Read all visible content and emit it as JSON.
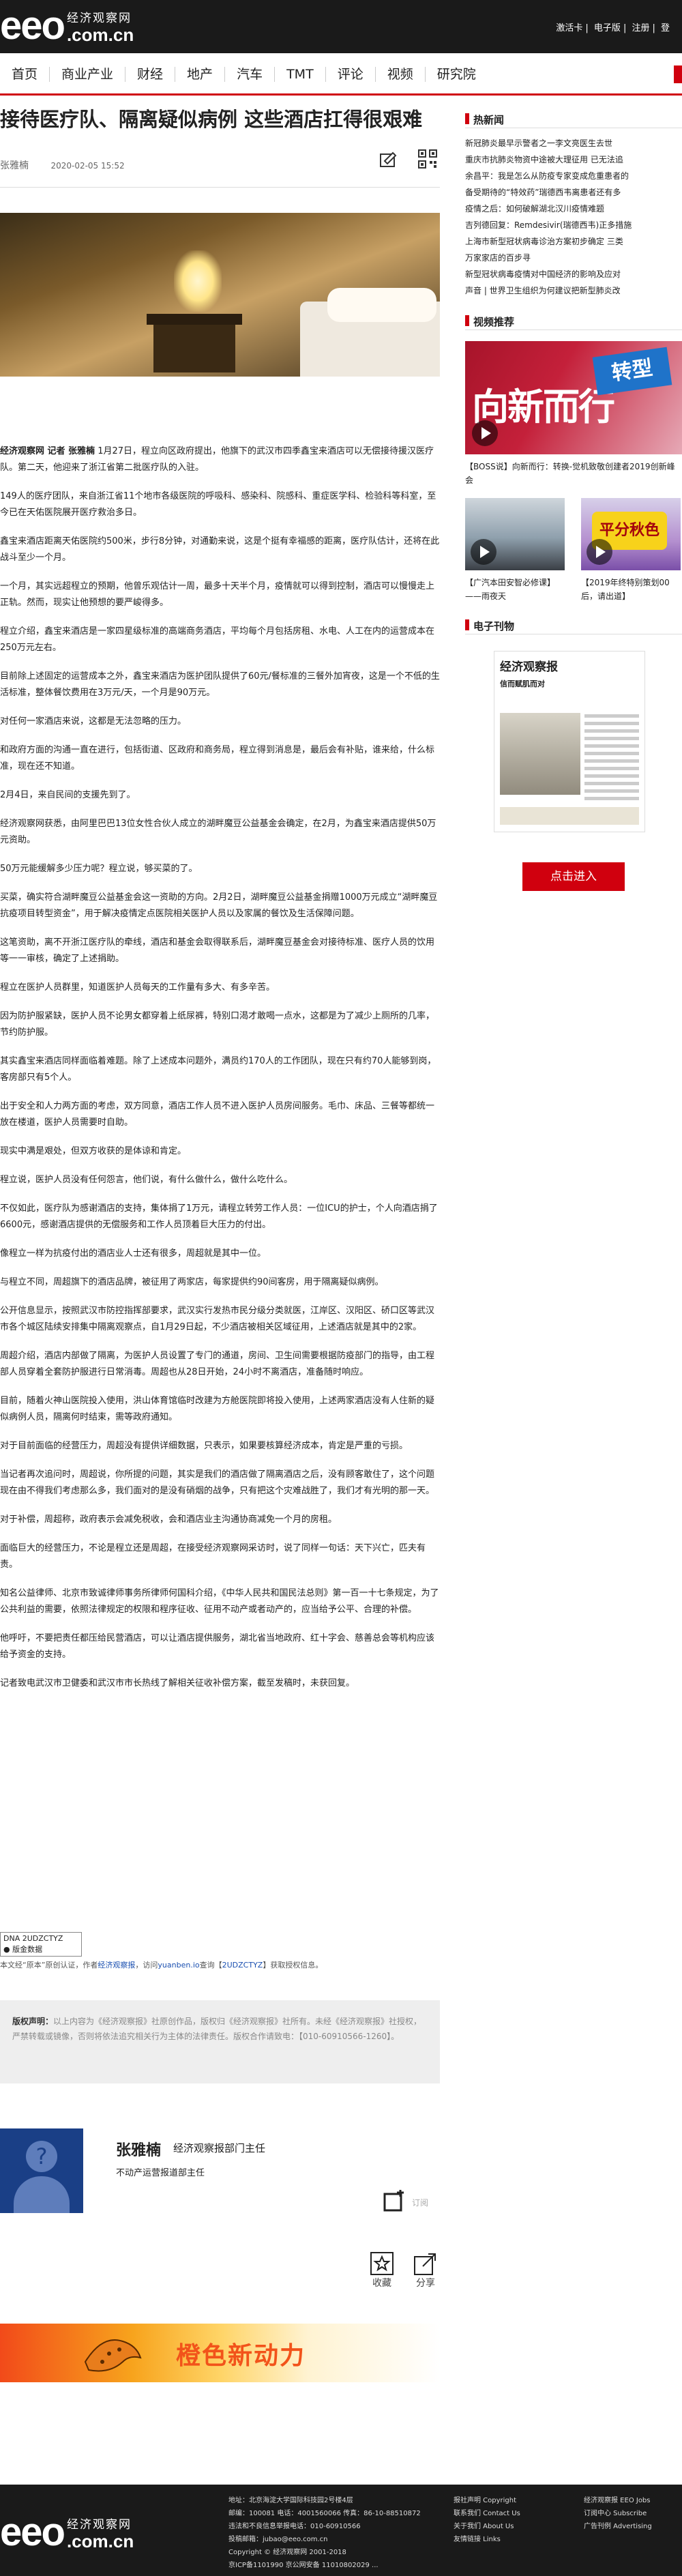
{
  "topbar": {
    "logo_word": "eeo",
    "logo_cn": "经济观察网",
    "logo_domain": ".com.cn",
    "links": [
      "激活卡",
      "电子版",
      "注册",
      "登"
    ]
  },
  "nav": [
    "首页",
    "商业产业",
    "财经",
    "地产",
    "汽车",
    "TMT",
    "评论",
    "视频",
    "研究院"
  ],
  "article": {
    "title": "接待医疗队、隔离疑似病例 这些酒店扛得很艰难",
    "author": "张雅楠",
    "date": "2020-02-05 15:52",
    "paragraphs": [
      [
        "经济观察网 记者 张雅楠",
        "1月27日，程立向区政府提出，他旗下的武汉市四季鑫宝来酒店可以无偿接待援汉医疗队。第二天，他迎来了浙江省第二批医疗队的入驻。"
      ],
      [
        "",
        "149人的医疗团队，来自浙江省11个地市各级医院的呼吸科、感染科、院感科、重症医学科、检验科等科室，至今已在天佑医院展开医疗救治多日。"
      ],
      [
        "",
        "鑫宝来酒店距离天佑医院约500米，步行8分钟，对通勤来说，这是个挺有幸福感的距离，医疗队估计，还将在此战斗至少一个月。"
      ],
      [
        "",
        "一个月，其实远超程立的预期，他曾乐观估计一周，最多十天半个月，疫情就可以得到控制，酒店可以慢慢走上正轨。然而，现实让他预想的要严峻得多。"
      ],
      [
        "",
        "程立介绍，鑫宝来酒店是一家四星级标准的高端商务酒店，平均每个月包括房租、水电、人工在内的运营成本在250万元左右。"
      ],
      [
        "",
        "目前除上述固定的运营成本之外，鑫宝来酒店为医护团队提供了60元/餐标准的三餐外加宵夜，这是一个不低的生活标准，整体餐饮费用在3万元/天，一个月是90万元。"
      ],
      [
        "",
        "对任何一家酒店来说，这都是无法忽略的压力。"
      ],
      [
        "",
        "和政府方面的沟通一直在进行，包括街道、区政府和商务局，程立得到消息是，最后会有补贴，谁来给，什么标准，现在还不知道。"
      ],
      [
        "",
        "2月4日，来自民间的支援先到了。"
      ],
      [
        "",
        "经济观察网获悉，由阿里巴巴13位女性合伙人成立的湖畔魔豆公益基金会确定，在2月，为鑫宝来酒店提供50万元资助。"
      ],
      [
        "",
        "50万元能缓解多少压力呢？程立说，够买菜的了。"
      ],
      [
        "",
        "买菜，确实符合湖畔魔豆公益基金会这一资助的方向。2月2日，湖畔魔豆公益基金捐赠1000万元成立“湖畔魔豆抗疫项目转型资金”，用于解决疫情定点医院相关医护人员以及家属的餐饮及生活保障问题。"
      ],
      [
        "",
        "这笔资助，离不开浙江医疗队的牵线，酒店和基金会取得联系后，湖畔魔豆基金会对接待标准、医疗人员的饮用等一一审核，确定了上述捐助。"
      ],
      [
        "",
        "程立在医护人员群里，知道医护人员每天的工作量有多大、有多辛苦。"
      ],
      [
        "",
        "因为防护服紧缺，医护人员不论男女都穿着上纸尿裤，特别口渴才敢喝一点水，这都是为了减少上厕所的几率，节约防护服。"
      ],
      [
        "",
        "其实鑫宝来酒店同样面临着难题。除了上述成本问题外，满员约170人的工作团队，现在只有约70人能够到岗，客房部只有5个人。"
      ],
      [
        "",
        "出于安全和人力两方面的考虑，双方同意，酒店工作人员不进入医护人员房间服务。毛巾、床品、三餐等都统一放在楼道，医护人员需要时自助。"
      ],
      [
        "",
        "现实中满是艰处，但双方收获的是体谅和肯定。"
      ],
      [
        "",
        "程立说，医护人员没有任何怨言，他们说，有什么做什么，做什么吃什么。"
      ],
      [
        "",
        "不仅如此，医疗队为感谢酒店的支持，集体捐了1万元，请程立转劳工作人员：一位ICU的护士，个人向酒店捐了6600元，感谢酒店提供的无偿服务和工作人员顶着巨大压力的付出。"
      ],
      [
        "",
        "像程立一样为抗疫付出的酒店业人士还有很多，周超就是其中一位。"
      ],
      [
        "",
        "与程立不同，周超旗下的酒店品牌，被征用了两家店，每家提供约90间客房，用于隔离疑似病例。"
      ],
      [
        "",
        "公开信息显示，按照武汉市防控指挥部要求，武汉实行发热市民分级分类就医，江岸区、汉阳区、硚口区等武汉市各个城区陆续安排集中隔离观察点，自1月29日起，不少酒店被相关区域征用，上述酒店就是其中的2家。"
      ],
      [
        "",
        "周超介绍，酒店内部做了隔离，为医护人员设置了专门的通道，房间、卫生间需要根据防疫部门的指导，由工程部人员穿着全套防护服进行日常消毒。周超也从28日开始，24小时不离酒店，准备随时响应。"
      ],
      [
        "",
        "目前，随着火神山医院投入使用，洪山体育馆临时改建为方舱医院即将投入使用，上述两家酒店没有人住新的疑似病例人员，隔离何时结束，需等政府通知。"
      ],
      [
        "",
        "对于目前面临的经营压力，周超没有提供详细数据，只表示，如果要核算经济成本，肯定是严重的亏损。"
      ],
      [
        "",
        "当记者再次追问时，周超说，你所提的问题，其实是我们的酒店做了隔离酒店之后，没有顾客敢住了，这个问题现在由不得我们考虑那么多，我们面对的是没有硝烟的战争，只有把这个灾难战胜了，我们才有光明的那一天。"
      ],
      [
        "",
        "对于补偿，周超称，政府表示会减免税收，会和酒店业主沟通协商减免一个月的房租。"
      ],
      [
        "",
        "面临巨大的经营压力，不论是程立还是周超，在接受经济观察网采访时，说了同样一句话：天下兴亡，匹夫有责。"
      ],
      [
        "",
        "知名公益律师、北京市致诚律师事务所律师何国科介绍，《中华人民共和国民法总则》第一百一十七条规定，为了公共利益的需要，依照法律规定的权限和程序征收、征用不动产或者动产的，应当给予公平、合理的补偿。"
      ],
      [
        "",
        "他呼吁，不要把责任都压给民营酒店，可以让酒店提供服务，湖北省当地政府、红十字会、慈善总会等机构应该给予资金的支持。"
      ],
      [
        "",
        "记者致电武汉市卫健委和武汉市市长热线了解相关征收补偿方案，截至发稿时，未获回复。"
      ]
    ],
    "stamp": [
      "DNA 2UDZCTYZ",
      "● 版金数据"
    ],
    "source": [
      "本文经“原本”原创认证，作者",
      "经济观察报",
      "，访问",
      "yuanben.io",
      "查询【",
      "2UDZCTYZ",
      "】获取授权信息。"
    ],
    "copyright_label": "版权声明：",
    "copyright_text": "以上内容为《经济观察报》社原创作品，版权归《经济观察报》社所有。未经《经济观察报》社授权，严禁转载或镜像，否则将依法追究相关行为主体的法律责任。版权合作请致电：【010-60910566-1260】。",
    "author_name": "张雅楠",
    "author_role": "经济观察报部门主任",
    "author_beat": "不动产运营报道部主任",
    "subscribe_label": "订阅",
    "collect_label": "收藏",
    "share_label": "分享"
  },
  "sidebar": {
    "hot_title": "热新闻",
    "hot_items": [
      "新冠肺炎最早示警者之一李文亮医生去世",
      "重庆市抗肺炎物资中途被大理征用 已无法追",
      "余昌平：我是怎么从防疫专家变成危重患者的",
      "备受期待的“特效药”瑞德西韦离患者还有多",
      "疫情之后：如何破解湖北汉川疫情难题",
      "吉列德回复：Remdesivir(瑞德西韦)正多措施",
      "上海市新型冠状病毒诊治方案初步确定 三类",
      "万家家店的百步寻",
      "新型冠状病毒疫情对中国经济的影响及应对",
      "声音 | 世界卫生组织为何建议把新型肺炎改"
    ],
    "video_title": "视频推荐",
    "video_main_art": [
      "向新而行",
      "转型"
    ],
    "video_main_caption": "【BOSS说】向新而行：转换-觉机致敬创建者2019创新峰会",
    "video_small": [
      {
        "caption": "【广汽本田安智必修课】——雨夜天"
      },
      {
        "badge": "平分秋色",
        "caption": "【2019年终特别策划00后，请出道】"
      }
    ],
    "paper_title": "电子刊物",
    "paper_masthead": "经济观察报",
    "paper_headline": "信而赋肌而对",
    "enter_label": "点击进入"
  },
  "banner": {
    "text": "橙色新动力"
  },
  "footer": {
    "addr_lines": [
      "地址：北京海淀大学国际科技园2号楼4层",
      "邮编：100081  电话：4001560066  传真：86-10-88510872",
      "违法和不良信息举报电话：010-60910566",
      "投稿邮箱：jubao@eeo.com.cn",
      "Copyright © 经济观察网 2001-2018",
      "京ICP备1101990  京公网安备 11010802029 ..."
    ],
    "links1": [
      "报社声明 Copyright",
      "联系我们 Contact Us",
      "关于我们 About Us",
      "友情链接 Links"
    ],
    "links2": [
      "经济观察报 EEO Jobs",
      "订阅中心 Subscribe",
      "广告刊例 Advertising"
    ]
  },
  "colors": {
    "brand_red": "#d0000e",
    "top_black": "#1a1a1a"
  }
}
